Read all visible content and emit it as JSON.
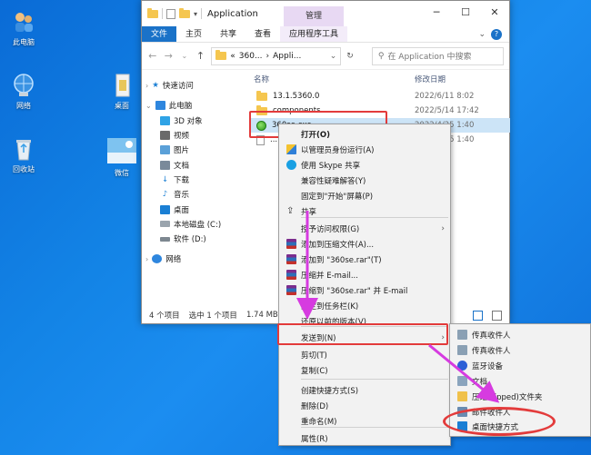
{
  "desktop": {
    "icons": [
      {
        "label": "此电脑",
        "icon": "computer-icon"
      },
      {
        "label": "网络",
        "icon": "network-icon"
      },
      {
        "label": "回收站",
        "icon": "recycle-bin-icon"
      },
      {
        "label": "桌面",
        "icon": "desktop-folder-icon"
      },
      {
        "label": "微信",
        "icon": "wechat-icon"
      }
    ]
  },
  "window": {
    "title": "Application",
    "manage_tab": "管理",
    "ribbon_tabs": [
      "文件",
      "主页",
      "共享",
      "查看",
      "应用程序工具"
    ],
    "address": {
      "prefix": "«",
      "part1": "360...",
      "part2": "Appli..."
    },
    "search_placeholder": "在 Application 中搜索",
    "nav": [
      {
        "label": "快速访问",
        "color": "#1a7fd4"
      },
      {
        "label": "此电脑",
        "color": "#2e86de"
      },
      {
        "label": "3D 对象",
        "color": "#2fa3e6"
      },
      {
        "label": "视频",
        "color": "#6a6a6a"
      },
      {
        "label": "图片",
        "color": "#5aa0d8"
      },
      {
        "label": "文档",
        "color": "#7a8a9a"
      },
      {
        "label": "下载",
        "color": "#1a7fd4"
      },
      {
        "label": "音乐",
        "color": "#1a7fd4"
      },
      {
        "label": "桌面",
        "color": "#1a7fd4"
      },
      {
        "label": "本地磁盘 (C:)",
        "color": "#9aa4ad"
      },
      {
        "label": "软件 (D:)",
        "color": "#7d8790"
      },
      {
        "label": "网络",
        "color": "#2e86de"
      }
    ],
    "columns": {
      "name": "名称",
      "date": "修改日期"
    },
    "files": [
      {
        "name": "13.1.5360.0",
        "date": "2022/6/11 8:02",
        "type": "folder"
      },
      {
        "name": "components",
        "date": "2022/5/14 17:42",
        "type": "folder"
      },
      {
        "name": "360se.exe",
        "date": "2022/4/25 1:40",
        "type": "exe"
      },
      {
        "name": "...",
        "date": "2022/4/25 1:40",
        "type": "file"
      }
    ],
    "status": {
      "count": "4 个项目",
      "selected": "选中 1 个项目",
      "size": "1.74 MB"
    }
  },
  "context_menu": {
    "items": [
      {
        "label": "打开(O)",
        "icon": "",
        "bold": true
      },
      {
        "label": "以管理员身份运行(A)",
        "icon": "shield-icon"
      },
      {
        "label": "使用 Skype 共享",
        "icon": "skype-icon"
      },
      {
        "label": "兼容性疑难解答(Y)",
        "icon": ""
      },
      {
        "label": "固定到\"开始\"屏幕(P)",
        "icon": ""
      },
      {
        "label": "共享",
        "icon": "share-icon"
      },
      {
        "label": "授予访问权限(G)",
        "icon": "",
        "submenu": true
      },
      {
        "label": "添加到压缩文件(A)...",
        "icon": "winrar-icon"
      },
      {
        "label": "添加到 \"360se.rar\"(T)",
        "icon": "winrar-icon"
      },
      {
        "label": "压缩并 E-mail...",
        "icon": "winrar-icon"
      },
      {
        "label": "压缩到 \"360se.rar\" 并 E-mail",
        "icon": "winrar-icon"
      },
      {
        "label": "固定到任务栏(K)",
        "icon": ""
      },
      {
        "label": "还原以前的版本(V)",
        "icon": ""
      },
      {
        "label": "发送到(N)",
        "icon": "",
        "submenu": true
      },
      {
        "label": "剪切(T)",
        "icon": ""
      },
      {
        "label": "复制(C)",
        "icon": ""
      },
      {
        "label": "创建快捷方式(S)",
        "icon": ""
      },
      {
        "label": "删除(D)",
        "icon": ""
      },
      {
        "label": "重命名(M)",
        "icon": ""
      },
      {
        "label": "属性(R)",
        "icon": ""
      }
    ]
  },
  "send_to_menu": {
    "items": [
      {
        "label": "传真收件人",
        "icon": "fax-icon"
      },
      {
        "label": "传真收件人",
        "icon": "fax-icon"
      },
      {
        "label": "蓝牙设备",
        "icon": "bluetooth-icon"
      },
      {
        "label": "文档",
        "icon": "document-icon"
      },
      {
        "label": "压缩(zipped)文件夹",
        "icon": "zip-folder-icon"
      },
      {
        "label": "邮件收件人",
        "icon": "mail-icon"
      },
      {
        "label": "桌面快捷方式",
        "icon": "desktop-shortcut-icon"
      }
    ]
  },
  "colors": {
    "accent": "#1a72c8",
    "highlight_red": "#e33b3b",
    "arrow_magenta": "#d63be0",
    "desktop_blue": "#1384e6"
  }
}
